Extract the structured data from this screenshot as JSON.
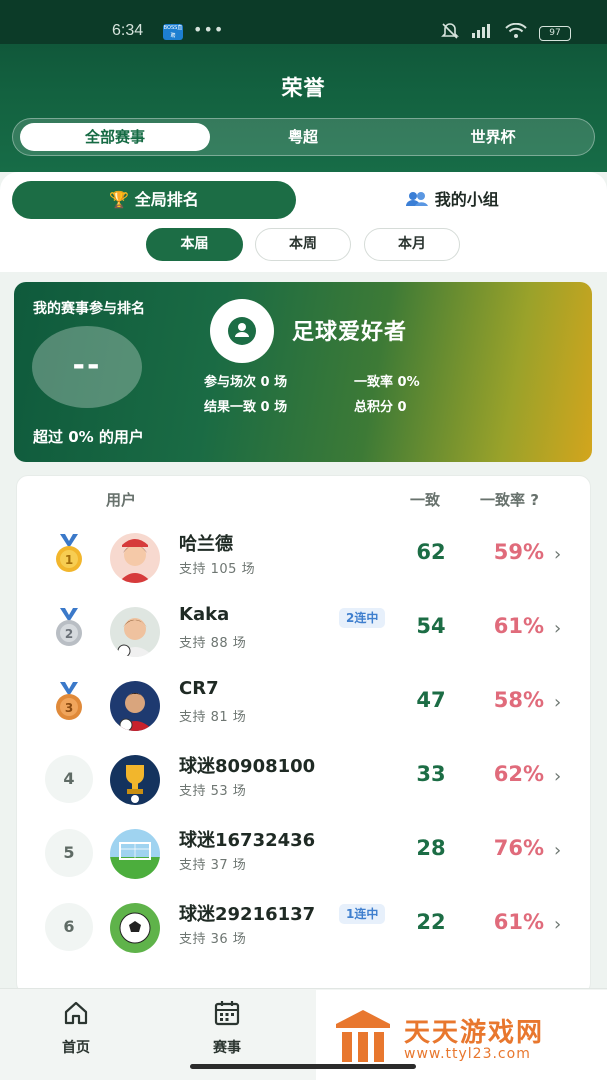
{
  "status_bar": {
    "time": "6:34",
    "badge": "BOSS直聘",
    "dots": "•••",
    "battery": "97"
  },
  "header": {
    "title": "荣誉"
  },
  "competition_tabs": [
    {
      "label": "全部赛事",
      "active": true
    },
    {
      "label": "粤超",
      "active": false
    },
    {
      "label": "世界杯",
      "active": false
    }
  ],
  "ranking_tabs": [
    {
      "label": "全局排名",
      "icon": "trophy-icon",
      "active": true
    },
    {
      "label": "我的小组",
      "icon": "group-icon",
      "active": false
    }
  ],
  "period_tabs": [
    {
      "label": "本届",
      "active": true
    },
    {
      "label": "本周",
      "active": false
    },
    {
      "label": "本月",
      "active": false
    }
  ],
  "my_card": {
    "label": "我的赛事参与排名",
    "rank": "--",
    "beat_text": "超过 0% 的用户",
    "name": "足球爱好者",
    "stats": {
      "played": "参与场次 0 场",
      "consistency_rate": "一致率 0%",
      "result_match": "结果一致 0 场",
      "total_points": "总积分 0"
    }
  },
  "board": {
    "headers": {
      "user": "用户",
      "match": "一致",
      "rate": "一致率 ?"
    },
    "rows": [
      {
        "rank": "1",
        "medal": "gold-medal-icon",
        "name": "哈兰德",
        "sub": "支持 105 场",
        "streak": "",
        "count": "62",
        "rate": "59%"
      },
      {
        "rank": "2",
        "medal": "silver-medal-icon",
        "name": "Kaka",
        "sub": "支持 88 场",
        "streak": "2连中",
        "count": "54",
        "rate": "61%"
      },
      {
        "rank": "3",
        "medal": "bronze-medal-icon",
        "name": "CR7",
        "sub": "支持 81 场",
        "streak": "",
        "count": "47",
        "rate": "58%"
      },
      {
        "rank": "4",
        "medal": "",
        "name": "球迷80908100",
        "sub": "支持 53 场",
        "streak": "",
        "count": "33",
        "rate": "62%"
      },
      {
        "rank": "5",
        "medal": "",
        "name": "球迷16732436",
        "sub": "支持 37 场",
        "streak": "",
        "count": "28",
        "rate": "76%"
      },
      {
        "rank": "6",
        "medal": "",
        "name": "球迷29216137",
        "sub": "支持 36 场",
        "streak": "1连中",
        "count": "22",
        "rate": "61%"
      }
    ],
    "chevron": "›"
  },
  "bottom_nav": [
    {
      "label": "首页",
      "icon": "home-icon"
    },
    {
      "label": "赛事",
      "icon": "calendar-icon"
    }
  ],
  "watermark": {
    "title": "天天游戏网",
    "url": "www.ttyl23.com"
  },
  "colors": {
    "brand_green": "#1c6d45",
    "rate_red": "#e06b7b",
    "streak_blue": "#3f7fce"
  }
}
